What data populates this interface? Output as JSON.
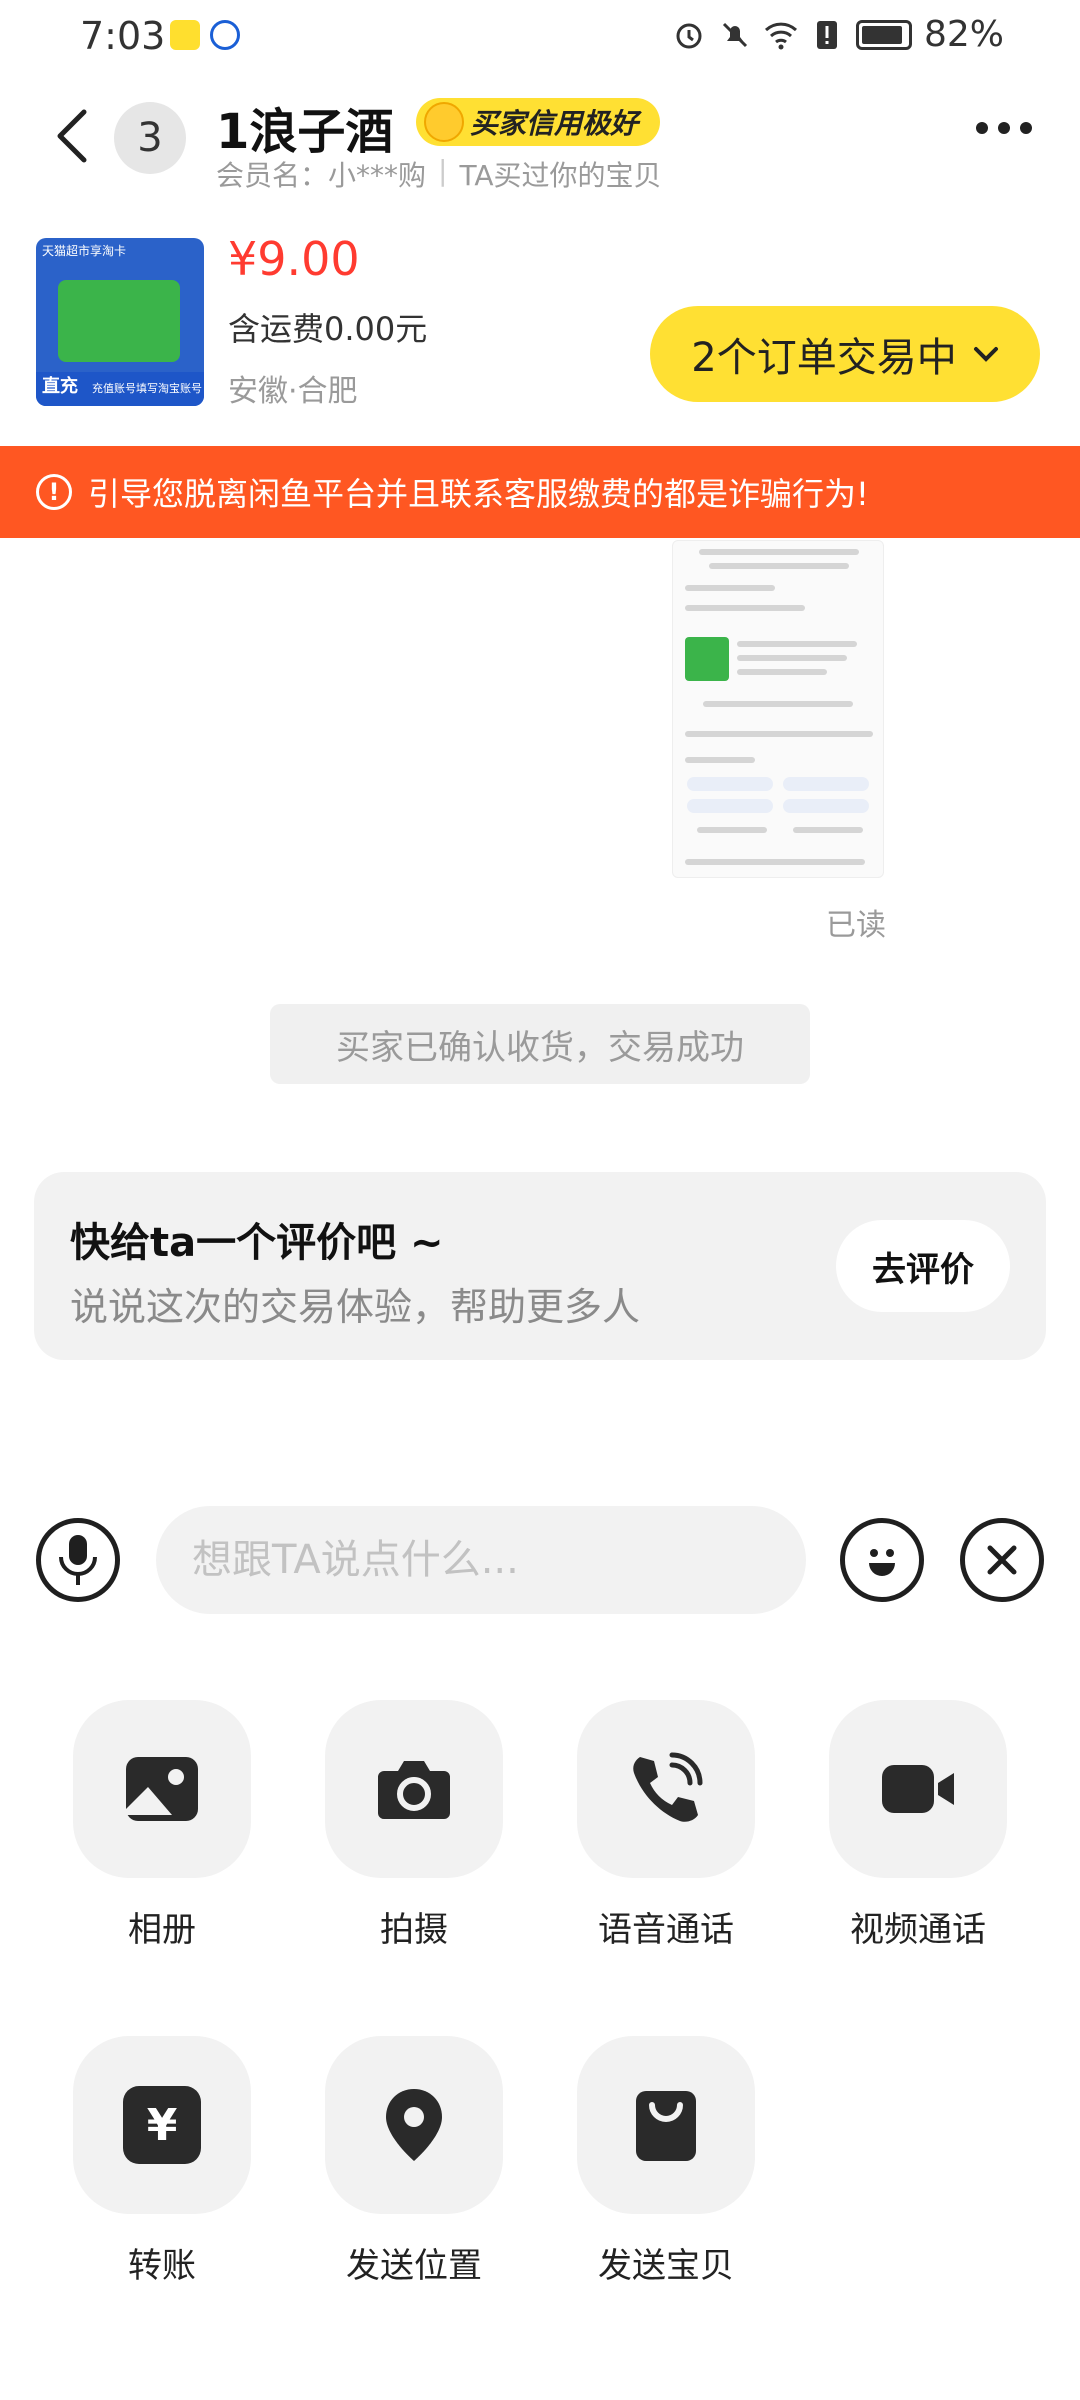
{
  "status_bar": {
    "time": "7:03",
    "battery": "82%",
    "battery_level": 0.82
  },
  "header": {
    "unread_count": "3",
    "seller_name": "1浪子酒",
    "credit_badge": "买家信用极好",
    "member_label": "会员名：",
    "member_name": "小***购",
    "member_note": "TA买过你的宝贝"
  },
  "product": {
    "price": "¥9.00",
    "shipping": "含运费0.00元",
    "location": "安徽·合肥",
    "thumb_top_text": "天猫超市享淘卡",
    "thumb_bottom_left": "直充",
    "thumb_bottom_text": "充值账号填写淘宝账号",
    "orders_button": "2个订单交易中"
  },
  "warning": {
    "text": "引导您脱离闲鱼平台并且联系客服缴费的都是诈骗行为!"
  },
  "chat": {
    "read_status": "已读",
    "system_message": "买家已确认收货，交易成功"
  },
  "review_card": {
    "title": "快给ta一个评价吧 ~",
    "subtitle": "说说这次的交易体验，帮助更多人",
    "button": "去评价"
  },
  "input": {
    "placeholder": "想跟TA说点什么..."
  },
  "tools": [
    {
      "label": "相册",
      "icon": "album-icon"
    },
    {
      "label": "拍摄",
      "icon": "camera-icon"
    },
    {
      "label": "语音通话",
      "icon": "phone-icon"
    },
    {
      "label": "视频通话",
      "icon": "video-icon"
    },
    {
      "label": "转账",
      "icon": "yuan-icon"
    },
    {
      "label": "发送位置",
      "icon": "location-icon"
    },
    {
      "label": "发送宝贝",
      "icon": "bag-icon"
    }
  ],
  "colors": {
    "accent_yellow": "#ffe033",
    "warning_orange": "#ff5722",
    "price_red": "#ff3b30"
  }
}
